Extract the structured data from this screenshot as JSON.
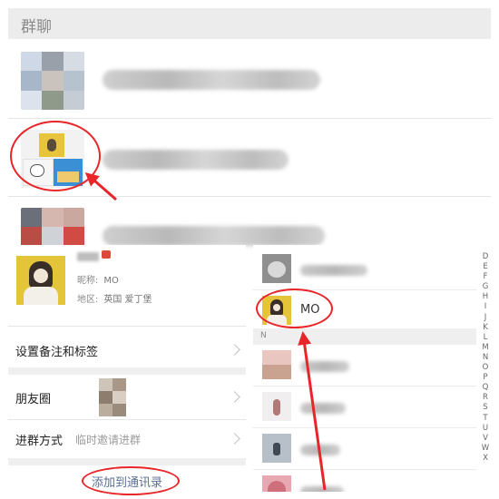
{
  "group_chats": {
    "header_title": "群聊"
  },
  "profile": {
    "nickname_label": "昵称:",
    "nickname_value": "MO",
    "region_label": "地区:",
    "region_value": "英国  爱丁堡",
    "rows": {
      "remark_label": "设置备注和标签",
      "moments_label": "朋友圈",
      "join_label": "进群方式",
      "join_value": "临时邀请进群"
    },
    "add_contact_button": "添加到通讯录"
  },
  "contacts": {
    "selected_contact_name": "MO",
    "section_header": "N",
    "index_letters": [
      "D",
      "E",
      "F",
      "G",
      "H",
      "I",
      "J",
      "K",
      "L",
      "M",
      "N",
      "O",
      "P",
      "Q",
      "R",
      "S",
      "T",
      "U",
      "V",
      "W",
      "X"
    ]
  },
  "colors": {
    "annotation_red": "#e8262a",
    "link_blue": "#5a6f93",
    "header_gray": "#ececec"
  },
  "icons": [
    "chevron-right-icon",
    "group-avatar-mosaic",
    "arrow-annotation"
  ]
}
